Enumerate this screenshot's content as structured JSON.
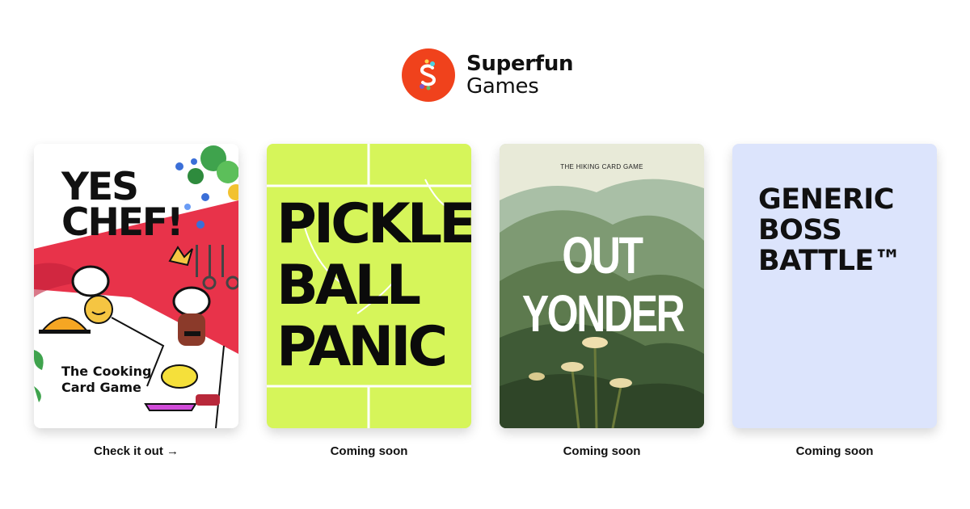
{
  "brand": {
    "name": "Superfun",
    "sub": "Games",
    "accent": "#f0421c"
  },
  "cards": [
    {
      "title_lines": [
        "YES",
        "CHEF!"
      ],
      "subtitle": "The Cooking Card Game",
      "caption": "Check it out →",
      "bg": "#ffffff",
      "icon": "chef-illustration"
    },
    {
      "title_lines": [
        "PICKLE",
        "BALL",
        "PANIC"
      ],
      "caption": "Coming soon",
      "bg": "#d6f55a",
      "icon": "pickleball-court"
    },
    {
      "kicker": "THE HIKING CARD GAME",
      "title_lines": [
        "OUT",
        "YONDER"
      ],
      "caption": "Coming soon",
      "bg": "#b9c8b0",
      "icon": "mountain-landscape"
    },
    {
      "title_lines": [
        "GENERIC",
        "BOSS",
        "BATTLE™"
      ],
      "caption": "Coming soon",
      "bg": "#dce4fc"
    }
  ]
}
